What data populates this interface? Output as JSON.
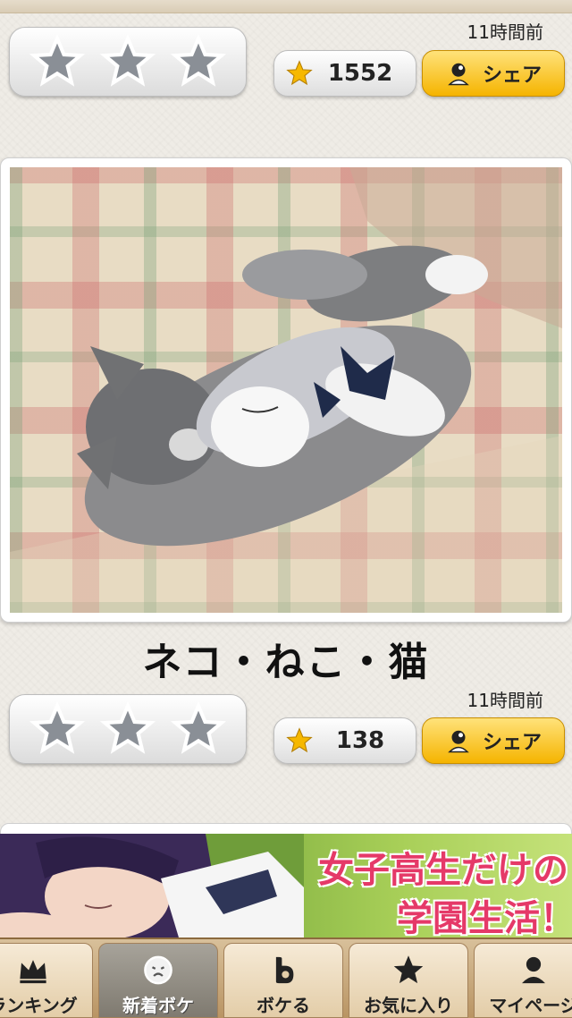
{
  "posts": [
    {
      "time": "11時間前",
      "star_count": "1552",
      "share_label": "シェア"
    },
    {
      "title": "ネコ・ねこ・猫",
      "time": "11時間前",
      "star_count": "138",
      "share_label": "シェア"
    }
  ],
  "ad": {
    "line1": "女子高生だけの",
    "line2": "学園生活！"
  },
  "tabs": [
    {
      "label": "ランキング",
      "icon": "crown-icon"
    },
    {
      "label": "新着ボケ",
      "icon": "face-icon",
      "active": true
    },
    {
      "label": "ボケる",
      "icon": "bokeru-b-icon"
    },
    {
      "label": "お気に入り",
      "icon": "star-icon"
    },
    {
      "label": "マイページ",
      "icon": "person-icon"
    }
  ],
  "colors": {
    "accent": "#f5b400",
    "star": "#f6b800",
    "ad_text": "#e53968"
  }
}
